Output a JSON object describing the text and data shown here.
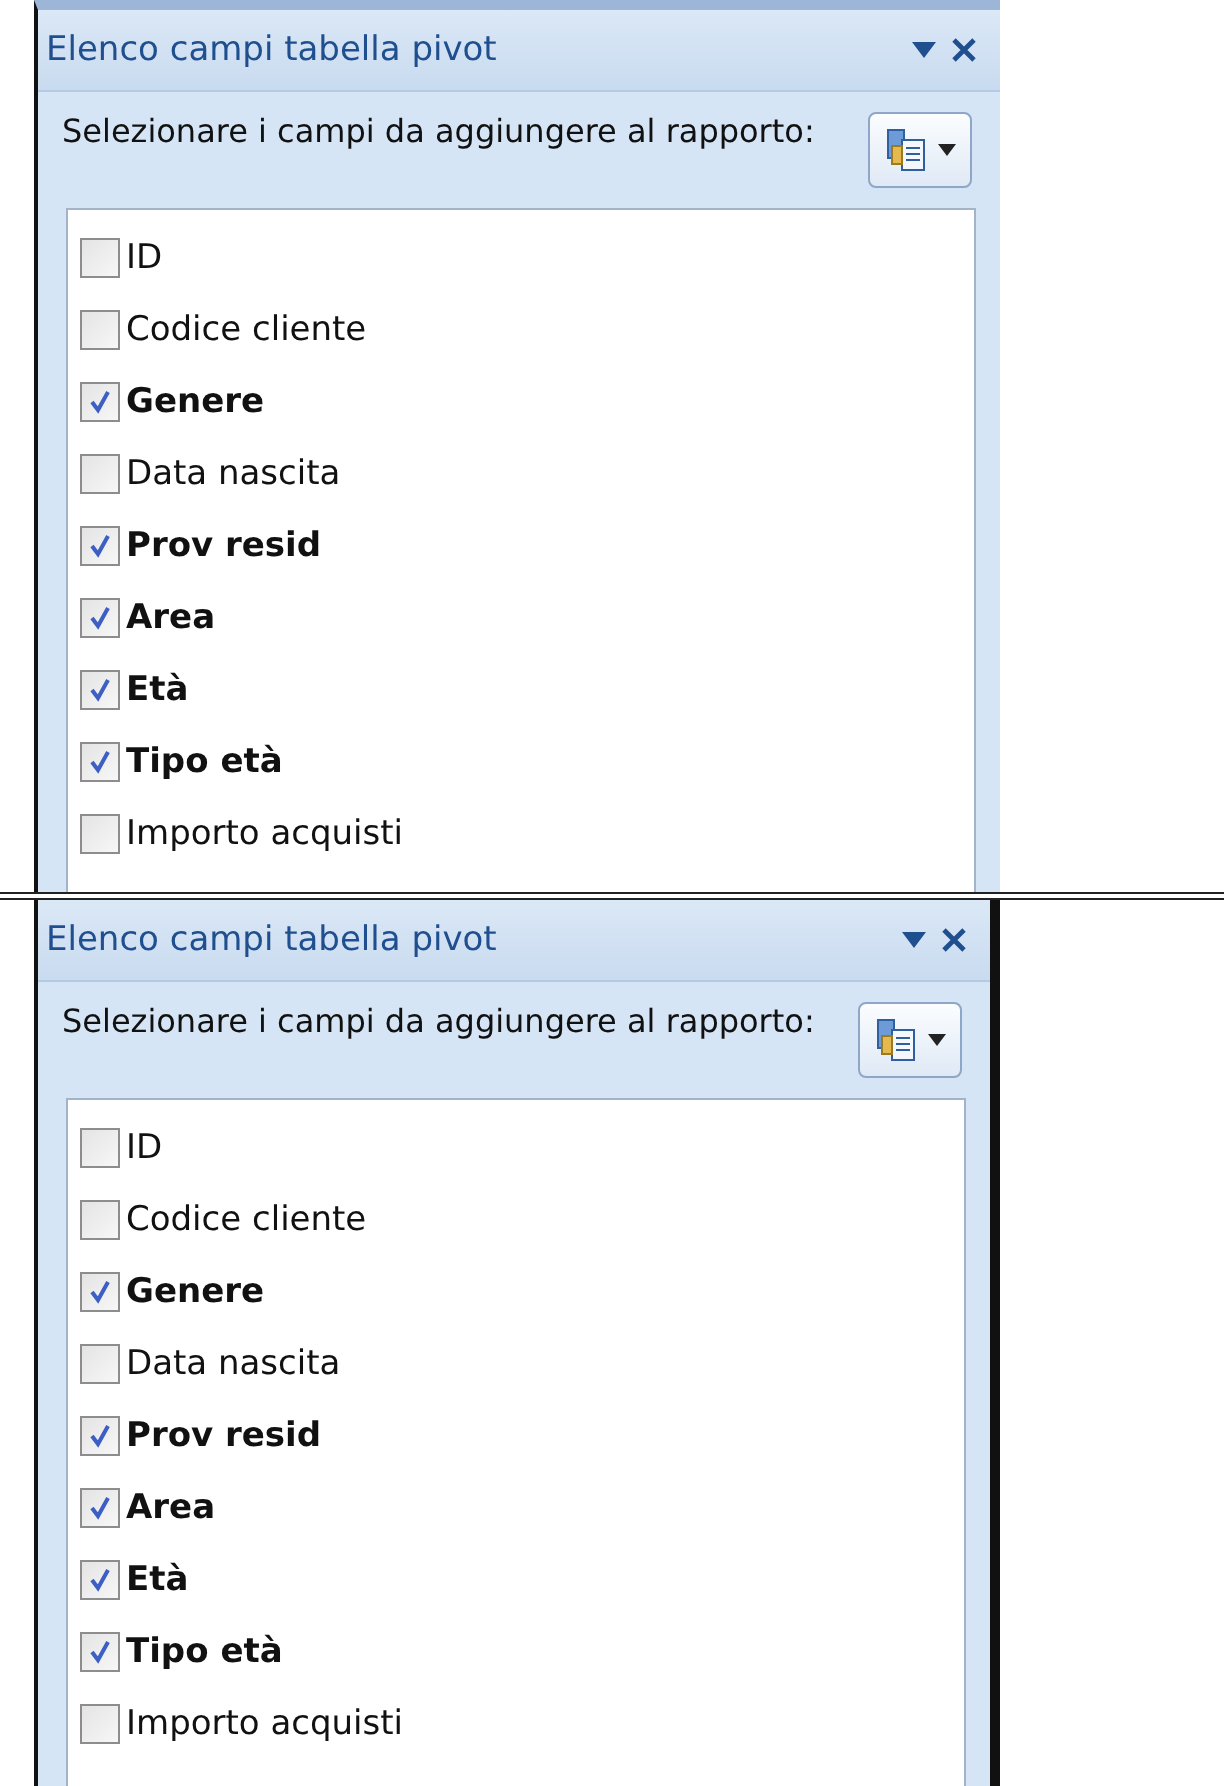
{
  "panels": [
    {
      "title": "Elenco campi tabella pivot",
      "instruction": "Selezionare i campi da aggiungere al rapporto:",
      "fields": [
        {
          "label": "ID",
          "checked": false
        },
        {
          "label": "Codice cliente",
          "checked": false
        },
        {
          "label": "Genere",
          "checked": true
        },
        {
          "label": "Data nascita",
          "checked": false
        },
        {
          "label": "Prov resid",
          "checked": true
        },
        {
          "label": "Area",
          "checked": true
        },
        {
          "label": "Età",
          "checked": true
        },
        {
          "label": "Tipo età",
          "checked": true
        },
        {
          "label": "Importo acquisti",
          "checked": false
        }
      ]
    },
    {
      "title": "Elenco campi tabella pivot",
      "instruction": "Selezionare i campi da aggiungere al rapporto:",
      "fields": [
        {
          "label": "ID",
          "checked": false
        },
        {
          "label": "Codice cliente",
          "checked": false
        },
        {
          "label": "Genere",
          "checked": true
        },
        {
          "label": "Data nascita",
          "checked": false
        },
        {
          "label": "Prov resid",
          "checked": true
        },
        {
          "label": "Area",
          "checked": true
        },
        {
          "label": "Età",
          "checked": true
        },
        {
          "label": "Tipo età",
          "checked": true
        },
        {
          "label": "Importo acquisti",
          "checked": false
        }
      ]
    }
  ]
}
